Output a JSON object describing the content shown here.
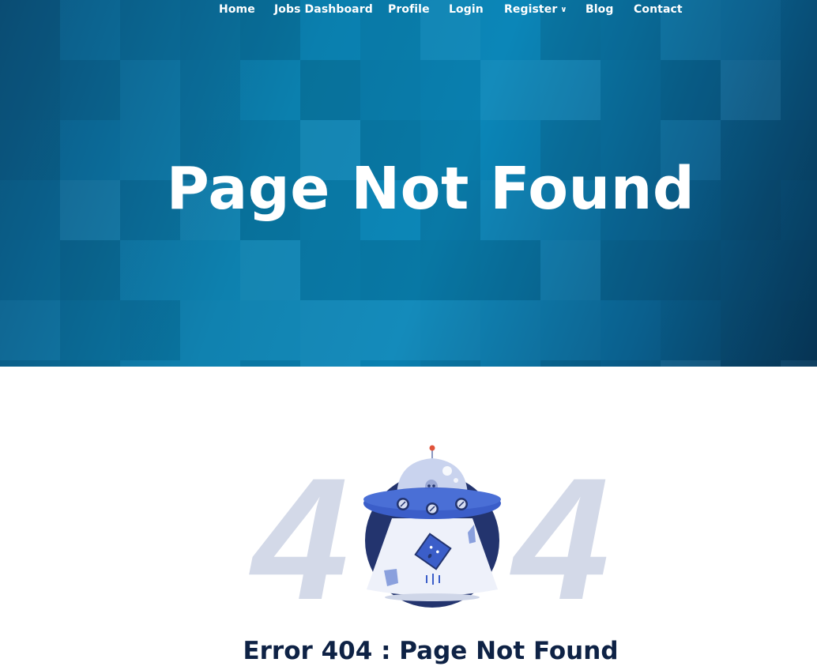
{
  "nav": {
    "items": [
      {
        "label": "Home"
      },
      {
        "label": "Jobs Dashboard"
      },
      {
        "label": "Profile"
      },
      {
        "label": "Login"
      },
      {
        "label": "Register"
      },
      {
        "label": "Blog"
      },
      {
        "label": "Contact"
      }
    ],
    "register_icon": "chevron-down-icon"
  },
  "hero": {
    "title": "Page Not Found"
  },
  "error": {
    "illustration_text": "404",
    "illustration_icon": "ufo-alien-icon",
    "title": "Error 404 : Page Not Found"
  },
  "colors": {
    "hero_primary": "#0a86b8",
    "hero_dark": "#07395c",
    "digit_color": "#d3d9e8",
    "ufo_blue": "#3b5ec9",
    "ufo_navy": "#23346e",
    "heading_dark": "#0e2245"
  }
}
